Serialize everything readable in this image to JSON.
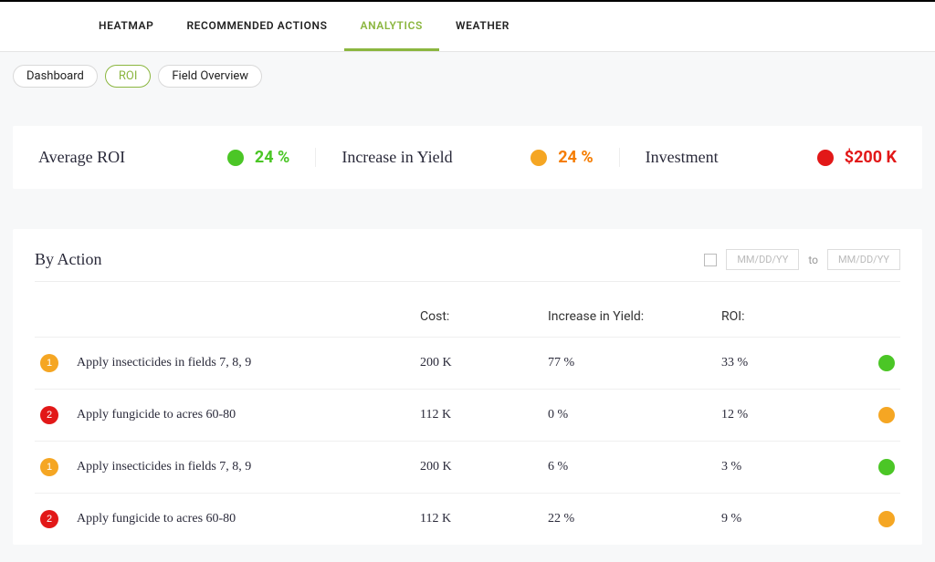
{
  "tabs": {
    "heatmap": "HEATMAP",
    "recommended": "RECOMMENDED ACTIONS",
    "analytics": "ANALYTICS",
    "weather": "WEATHER"
  },
  "pills": {
    "dashboard": "Dashboard",
    "roi": "ROI",
    "overview": "Field Overview"
  },
  "cards": {
    "avg_roi": {
      "label": "Average ROI",
      "value": "24 %",
      "color": "green"
    },
    "yield": {
      "label": "Increase in Yield",
      "value": "24 %",
      "color": "orange"
    },
    "invest": {
      "label": "Investment",
      "value": "$200 K",
      "color": "red",
      "dotcolor": "red"
    }
  },
  "panel": {
    "title": "By Action",
    "date_placeholder": "MM/DD/YY",
    "to": "to",
    "columns": {
      "cost": "Cost:",
      "yield": "Increase in Yield:",
      "roi": "ROI:"
    },
    "rows": [
      {
        "badge": "1",
        "badge_color": "orange",
        "action": "Apply insecticides in fields 7, 8, 9",
        "cost": "200 K",
        "yield": "77 %",
        "roi": "33 %",
        "status": "green"
      },
      {
        "badge": "2",
        "badge_color": "red",
        "action": "Apply fungicide to acres 60-80",
        "cost": "112 K",
        "yield": "0 %",
        "roi": "12 %",
        "status": "orange"
      },
      {
        "badge": "1",
        "badge_color": "orange",
        "action": "Apply insecticides in fields 7, 8, 9",
        "cost": "200 K",
        "yield": "6 %",
        "roi": "3 %",
        "status": "green"
      },
      {
        "badge": "2",
        "badge_color": "red",
        "action": "Apply fungicide to acres 60-80",
        "cost": "112 K",
        "yield": "22 %",
        "roi": "9 %",
        "status": "orange"
      }
    ]
  }
}
